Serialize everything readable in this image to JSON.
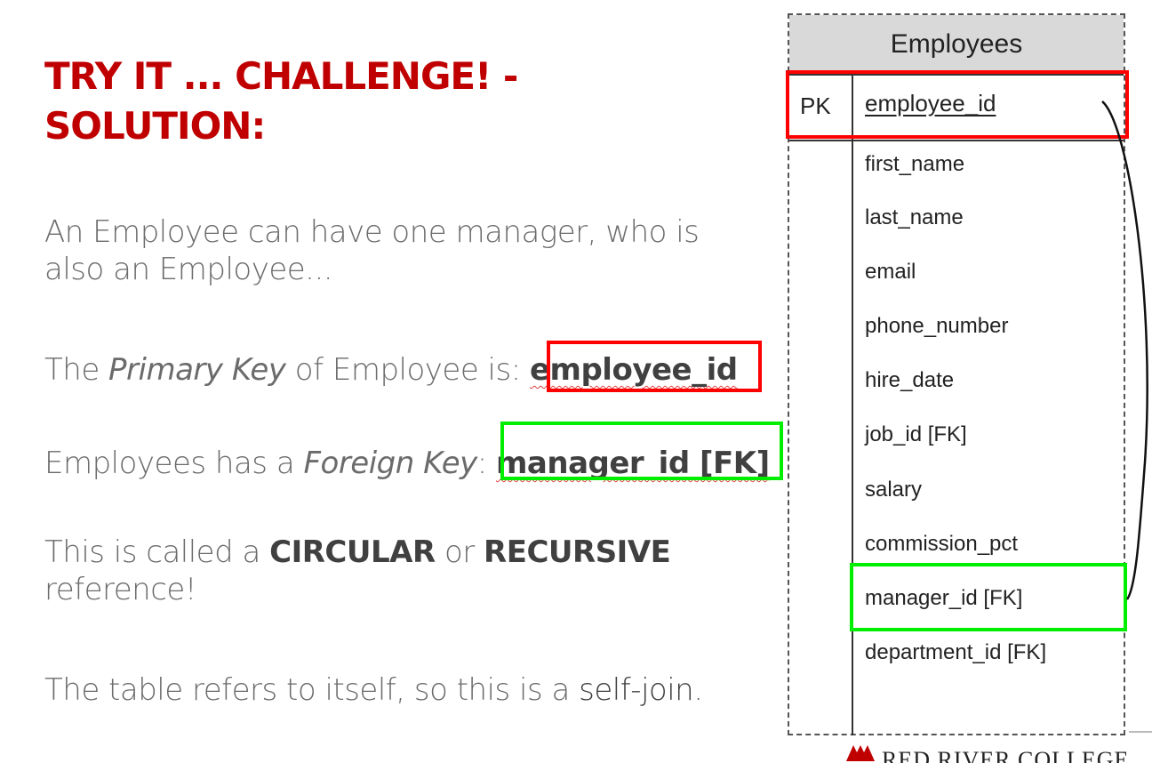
{
  "title": {
    "line1": "TRY IT ... CHALLENGE! -",
    "line2": "SOLUTION:"
  },
  "paragraphs": {
    "p1_line1": "An Employee can have one manager, who is",
    "p1_line2": "also an Employee...",
    "p2_prefix": "The ",
    "p2_italic": "Primary Key",
    "p2_middle": " of Employee is: ",
    "p2_key": "employee_id",
    "p3_prefix": "Employees has a ",
    "p3_italic": "Foreign Key",
    "p3_middle": ": ",
    "p3_key": "manager_id [FK]",
    "p4_prefix": "This is called a ",
    "p4_bold1": "CIRCULAR",
    "p4_or": " or ",
    "p4_bold2": "RECURSIVE",
    "p4_line2": "reference!",
    "p5_prefix": "The table refers to itself, so this is a ",
    "p5_strong": "self-join",
    "p5_suffix": "."
  },
  "er_table": {
    "name": "Employees",
    "pk_label": "PK",
    "primary_key": "employee_id",
    "fields": [
      "first_name",
      "last_name",
      "email",
      "phone_number",
      "hire_date",
      "job_id [FK]",
      "salary",
      "commission_pct",
      "manager_id [FK]",
      "department_id [FK]"
    ]
  },
  "logo": {
    "text": "RED RIVER COLLEGE"
  },
  "colors": {
    "title": "#c00000",
    "highlight_red": "#ff0000",
    "highlight_green": "#00ee00"
  }
}
